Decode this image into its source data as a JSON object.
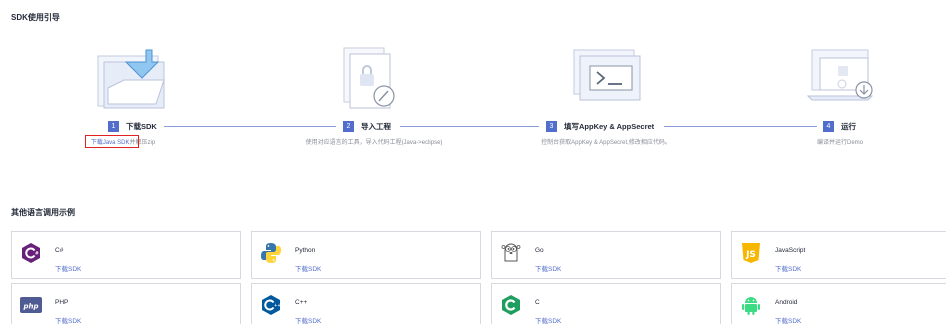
{
  "sdk_guide": {
    "title": "SDK使用引导",
    "steps": [
      {
        "num": "1",
        "label": "下载SDK",
        "icon": "folder-download-icon"
      },
      {
        "num": "2",
        "label": "导入工程",
        "icon": "document-lock-icon",
        "desc": "使用对应语言的工具，导入代码工程(Java->eclipse)"
      },
      {
        "num": "3",
        "label": "填写AppKey & AppSecret",
        "icon": "terminal-window-icon",
        "desc": "控制台获取AppKey & AppSecret,修改相应代码。"
      },
      {
        "num": "4",
        "label": "运行",
        "icon": "laptop-run-icon",
        "desc": "编译并运行Demo"
      }
    ],
    "step1_desc": {
      "link": "下载Java SDK",
      "rest": "并解压zip"
    }
  },
  "languages": {
    "title": "其他语言调用示例",
    "download_label": "下载SDK",
    "items": [
      {
        "name": "C#",
        "icon": "csharp-icon",
        "color": "#68217a"
      },
      {
        "name": "Python",
        "icon": "python-icon",
        "color": "#3776ab"
      },
      {
        "name": "Go",
        "icon": "go-gopher-icon",
        "color": "#555555"
      },
      {
        "name": "JavaScript",
        "icon": "javascript-icon",
        "color": "#f7b600"
      },
      {
        "name": "PHP",
        "icon": "php-icon",
        "color": "#4f5b93"
      },
      {
        "name": "C++",
        "icon": "cpp-icon",
        "color": "#00599c"
      },
      {
        "name": "C",
        "icon": "c-icon",
        "color": "#1e9e5f"
      },
      {
        "name": "Android",
        "icon": "android-icon",
        "color": "#3ddc84"
      }
    ]
  }
}
